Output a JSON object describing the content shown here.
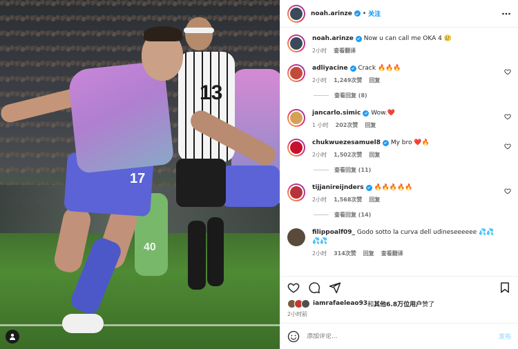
{
  "photo": {
    "jersey_number": "17",
    "opponent_number": "13",
    "keeper_number": "40"
  },
  "header": {
    "username": "noah.arinze",
    "separator": "•",
    "follow_label": "关注"
  },
  "caption": {
    "username": "noah.arinze",
    "text": "Now u can call me OKA 4 🥲",
    "time": "2小时",
    "translate_label": "查看翻译"
  },
  "comments": [
    {
      "username": "adliyacine",
      "text": "Crack 🔥🔥🔥",
      "time": "2小时",
      "likes": "1,249次赞",
      "reply_label": "回复",
      "view_replies": "查看回复 (8)",
      "avatar_color": "#c24a3a"
    },
    {
      "username": "jancarlo.simic",
      "text": "Wow.❤️",
      "time": "1 小时",
      "likes": "202次赞",
      "reply_label": "回复",
      "view_replies": "",
      "avatar_color": "#d5a255"
    },
    {
      "username": "chukwuezesamuel8",
      "text": "My bro ❤️🔥",
      "time": "2小时",
      "likes": "1,502次赞",
      "reply_label": "回复",
      "view_replies": "查看回复 (11)",
      "avatar_color": "#c8102e"
    },
    {
      "username": "tijjanireijnders",
      "text": "🔥🔥🔥🔥🔥",
      "time": "2小时",
      "likes": "1,568次赞",
      "reply_label": "回复",
      "view_replies": "查看回复 (14)",
      "avatar_color": "#b8323b"
    },
    {
      "username": "filippoalf09_",
      "text": "Godo sotto la curva dell udineseeeeee 💦💦💦💦",
      "time": "2小时",
      "likes": "314次赞",
      "reply_label": "回复",
      "translate_label": "查看翻译",
      "view_replies": "",
      "avatar_color": "#5a4a3c"
    }
  ],
  "likes": {
    "liker": "iamrafaeleao93",
    "middle": "和",
    "others": "其他6.8万位用户",
    "suffix": "赞了"
  },
  "post_time": "2小时前",
  "comment_box": {
    "placeholder": "添加评论...",
    "post_label": "发布"
  },
  "colors": {
    "link_blue": "#0095f6",
    "verified_blue": "#1d9bf0",
    "muted_gray": "#737373",
    "post_disabled": "#b2dffc"
  }
}
